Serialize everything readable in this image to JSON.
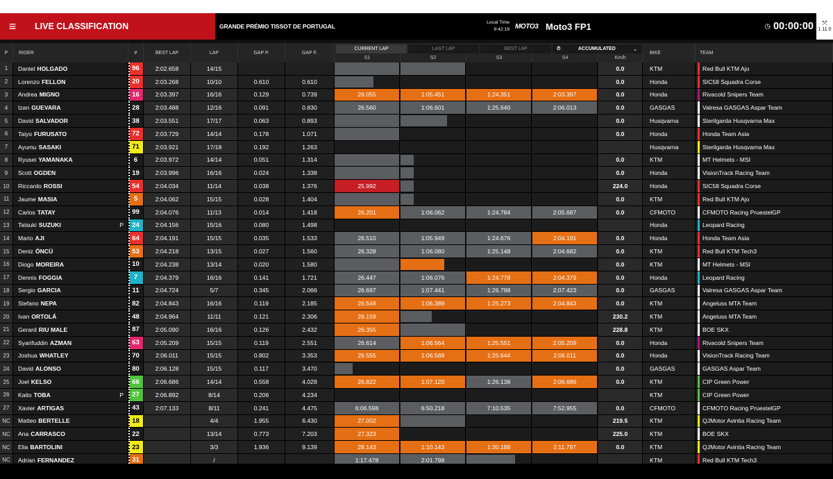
{
  "header": {
    "menu_icon": "hamburger-icon",
    "title": "LIVE CLASSIFICATION",
    "event": "GRANDE PRÉMIO TISSOT DE PORTUGAL",
    "local_time_label": "Local Time",
    "local_time": "9:42:19",
    "logo": "MOTO3",
    "session": "Moto3 FP1",
    "clock": "00:00:00",
    "version": "1.11.0"
  },
  "columns": {
    "p": "P",
    "rider": "RIDER",
    "num": "#",
    "best": "BEST LAP",
    "lap": "LAP",
    "gapp": "GAP P.",
    "gapf": "GAP F.",
    "tab_current": "CURRENT LAP",
    "tab_last": "LAST LAP",
    "tab_best": "BEST LAP",
    "accumulated": "ACCUMULATED",
    "s1": "S1",
    "s2": "S2",
    "s3": "S3",
    "s4": "S4",
    "kmh": "Km/h",
    "bike": "BIKE",
    "team": "TEAM"
  },
  "colors": {
    "orange": "#e56f14",
    "red": "#c51e25",
    "grey": "#5b5d61"
  },
  "rows": [
    {
      "p": "1",
      "first": "Daniel",
      "last": "HOLGADO",
      "num": "96",
      "nb": "#e8312c",
      "nc": "#fff",
      "best": "2:02.658",
      "lap": "14/15",
      "gapp": "",
      "gapf": "",
      "s": [
        [
          "g",
          100,
          ""
        ],
        [
          "g",
          100,
          ""
        ],
        [
          "",
          0,
          ""
        ],
        [
          "",
          0,
          ""
        ]
      ],
      "kmh": "0.0",
      "bike": "KTM",
      "team": "Red Bull KTM Ajo",
      "tc": "#e8312c"
    },
    {
      "p": "2",
      "first": "Lorenzo",
      "last": "FELLON",
      "num": "20",
      "nb": "#e8312c",
      "nc": "#fff",
      "best": "2:03.268",
      "lap": "10/10",
      "gapp": "0.610",
      "gapf": "0.610",
      "s": [
        [
          "g",
          60,
          ""
        ],
        [
          "",
          0,
          ""
        ],
        [
          "",
          0,
          ""
        ],
        [
          "",
          0,
          ""
        ]
      ],
      "kmh": "0.0",
      "bike": "Honda",
      "team": "SIC58 Squadra Corse",
      "tc": "#e8312c"
    },
    {
      "p": "3",
      "first": "Andrea",
      "last": "MIGNO",
      "num": "16",
      "nb": "#e0266e",
      "nc": "#fff",
      "best": "2:03.397",
      "lap": "16/16",
      "gapp": "0.129",
      "gapf": "0.739",
      "s": [
        [
          "o",
          100,
          "26.055"
        ],
        [
          "o",
          100,
          "1:05.451"
        ],
        [
          "o",
          100,
          "1:24.351"
        ],
        [
          "o",
          100,
          "2:03.397"
        ]
      ],
      "kmh": "0.0",
      "bike": "Honda",
      "team": "Rivacold Snipers Team",
      "tc": "#b5127a"
    },
    {
      "p": "4",
      "first": "Izan",
      "last": "GUEVARA",
      "num": "28",
      "nb": "",
      "nc": "#fff",
      "best": "2:03.488",
      "lap": "12/16",
      "gapp": "0.091",
      "gapf": "0.830",
      "s": [
        [
          "g",
          100,
          "26.560"
        ],
        [
          "g",
          100,
          "1:06.601"
        ],
        [
          "g",
          100,
          "1:25.640"
        ],
        [
          "g",
          100,
          "2:06.013"
        ]
      ],
      "kmh": "0.0",
      "bike": "GASGAS",
      "team": "Valresa GASGAS Aspar Team",
      "tc": "#fff"
    },
    {
      "p": "5",
      "first": "David",
      "last": "SALVADOR",
      "num": "38",
      "nb": "",
      "nc": "#fff",
      "best": "2:03.551",
      "lap": "17/17",
      "gapp": "0.063",
      "gapf": "0.893",
      "s": [
        [
          "g",
          100,
          ""
        ],
        [
          "g",
          72,
          ""
        ],
        [
          "",
          0,
          ""
        ],
        [
          "",
          0,
          ""
        ]
      ],
      "kmh": "0.0",
      "bike": "Husqvarna",
      "team": "Sterilgarda Husqvarna Max",
      "tc": "#fff"
    },
    {
      "p": "6",
      "first": "Taiyo",
      "last": "FURUSATO",
      "num": "72",
      "nb": "#e8312c",
      "nc": "#fff",
      "best": "2:03.729",
      "lap": "14/14",
      "gapp": "0.178",
      "gapf": "1.071",
      "s": [
        [
          "g",
          100,
          ""
        ],
        [
          "",
          0,
          ""
        ],
        [
          "",
          0,
          ""
        ],
        [
          "",
          0,
          ""
        ]
      ],
      "kmh": "0.0",
      "bike": "Honda",
      "team": "Honda Team Asia",
      "tc": "#e8312c"
    },
    {
      "p": "7",
      "first": "Ayumu",
      "last": "SASAKI",
      "num": "71",
      "nb": "#f1ea1c",
      "nc": "#000",
      "best": "2:03.921",
      "lap": "17/18",
      "gapp": "0.192",
      "gapf": "1.263",
      "s": [
        [
          "",
          0,
          ""
        ],
        [
          "",
          0,
          ""
        ],
        [
          "",
          0,
          ""
        ],
        [
          "",
          0,
          ""
        ]
      ],
      "kmh": "",
      "bike": "Husqvarna",
      "team": "Sterilgarda Husqvarna Max",
      "tc": "#f1ea1c"
    },
    {
      "p": "8",
      "first": "Ryusei",
      "last": "YAMANAKA",
      "num": "6",
      "nb": "",
      "nc": "#fff",
      "best": "2:03.972",
      "lap": "14/14",
      "gapp": "0.051",
      "gapf": "1.314",
      "s": [
        [
          "g",
          100,
          ""
        ],
        [
          "g",
          20,
          ""
        ],
        [
          "",
          0,
          ""
        ],
        [
          "",
          0,
          ""
        ]
      ],
      "kmh": "0.0",
      "bike": "KTM",
      "team": "MT Helmets - MSI",
      "tc": "#fff"
    },
    {
      "p": "9",
      "first": "Scott",
      "last": "OGDEN",
      "num": "19",
      "nb": "",
      "nc": "#fff",
      "best": "2:03.996",
      "lap": "16/16",
      "gapp": "0.024",
      "gapf": "1.338",
      "s": [
        [
          "g",
          100,
          ""
        ],
        [
          "g",
          20,
          ""
        ],
        [
          "",
          0,
          ""
        ],
        [
          "",
          0,
          ""
        ]
      ],
      "kmh": "0.0",
      "bike": "Honda",
      "team": "VisionTrack Racing Team",
      "tc": "#fff"
    },
    {
      "p": "10",
      "first": "Riccardo",
      "last": "ROSSI",
      "num": "54",
      "nb": "#e8312c",
      "nc": "#fff",
      "best": "2:04.034",
      "lap": "11/14",
      "gapp": "0.038",
      "gapf": "1.376",
      "s": [
        [
          "r",
          100,
          "25.992"
        ],
        [
          "g",
          20,
          ""
        ],
        [
          "",
          0,
          ""
        ],
        [
          "",
          0,
          ""
        ]
      ],
      "kmh": "224.0",
      "bike": "Honda",
      "team": "SIC58 Squadra Corse",
      "tc": "#e8312c"
    },
    {
      "p": "11",
      "first": "Jaume",
      "last": "MASIA",
      "num": "5",
      "nb": "#e56f14",
      "nc": "#fff",
      "best": "2:04.062",
      "lap": "15/15",
      "gapp": "0.028",
      "gapf": "1.404",
      "s": [
        [
          "g",
          100,
          ""
        ],
        [
          "g",
          20,
          ""
        ],
        [
          "",
          0,
          ""
        ],
        [
          "",
          0,
          ""
        ]
      ],
      "kmh": "0.0",
      "bike": "KTM",
      "team": "Red Bull KTM Ajo",
      "tc": "#e8312c"
    },
    {
      "p": "12",
      "first": "Carlos",
      "last": "TATAY",
      "num": "99",
      "nb": "",
      "nc": "#fff",
      "best": "2:04.076",
      "lap": "11/13",
      "gapp": "0.014",
      "gapf": "1.418",
      "s": [
        [
          "o",
          100,
          "26.201"
        ],
        [
          "g",
          100,
          "1:06.062"
        ],
        [
          "g",
          100,
          "1:24.784"
        ],
        [
          "g",
          100,
          "2:05.687"
        ]
      ],
      "kmh": "0.0",
      "bike": "CFMOTO",
      "team": "CFMOTO Racing PruestelGP",
      "tc": "#fff"
    },
    {
      "p": "13",
      "first": "Tatsuki",
      "last": "SUZUKI",
      "pen": "P",
      "num": "24",
      "nb": "#1fb3c7",
      "nc": "#fff",
      "best": "2:04.156",
      "lap": "15/16",
      "gapp": "0.080",
      "gapf": "1.498",
      "s": [
        [
          "",
          0,
          ""
        ],
        [
          "",
          0,
          ""
        ],
        [
          "",
          0,
          ""
        ],
        [
          "",
          0,
          ""
        ]
      ],
      "kmh": "",
      "bike": "Honda",
      "team": "Leopard Racing",
      "tc": "#1fb3c7"
    },
    {
      "p": "14",
      "first": "Mario",
      "last": "AJI",
      "num": "64",
      "nb": "#e8312c",
      "nc": "#fff",
      "best": "2:04.191",
      "lap": "15/15",
      "gapp": "0.035",
      "gapf": "1.533",
      "s": [
        [
          "g",
          100,
          "26.510"
        ],
        [
          "g",
          100,
          "1:05.949"
        ],
        [
          "g",
          100,
          "1:24.676"
        ],
        [
          "o",
          100,
          "2:04.191"
        ]
      ],
      "kmh": "0.0",
      "bike": "Honda",
      "team": "Honda Team Asia",
      "tc": "#e8312c"
    },
    {
      "p": "15",
      "first": "Deniz",
      "last": "ÖNCÜ",
      "num": "53",
      "nb": "#e56f14",
      "nc": "#fff",
      "best": "2:04.218",
      "lap": "13/15",
      "gapp": "0.027",
      "gapf": "1.560",
      "s": [
        [
          "g",
          100,
          "26.328"
        ],
        [
          "g",
          100,
          "1:06.080"
        ],
        [
          "g",
          100,
          "1:25.148"
        ],
        [
          "g",
          100,
          "2:04.682"
        ]
      ],
      "kmh": "0.0",
      "bike": "KTM",
      "team": "Red Bull KTM Tech3",
      "tc": "#e8312c"
    },
    {
      "p": "16",
      "first": "Diogo",
      "last": "MOREIRA",
      "num": "10",
      "nb": "",
      "nc": "#fff",
      "best": "2:04.238",
      "lap": "13/14",
      "gapp": "0.020",
      "gapf": "1.580",
      "s": [
        [
          "g",
          100,
          ""
        ],
        [
          "o",
          68,
          ""
        ],
        [
          "",
          0,
          ""
        ],
        [
          "",
          0,
          ""
        ]
      ],
      "kmh": "0.0",
      "bike": "KTM",
      "team": "MT Helmets - MSI",
      "tc": "#fff"
    },
    {
      "p": "17",
      "first": "Dennis",
      "last": "FOGGIA",
      "num": "7",
      "nb": "#1fb3c7",
      "nc": "#fff",
      "best": "2:04.379",
      "lap": "16/16",
      "gapp": "0.141",
      "gapf": "1.721",
      "s": [
        [
          "g",
          100,
          "26.447"
        ],
        [
          "g",
          100,
          "1:06.076"
        ],
        [
          "o",
          100,
          "1:24.778"
        ],
        [
          "o",
          100,
          "2:04.379"
        ]
      ],
      "kmh": "0.0",
      "bike": "Honda",
      "team": "Leopard Racing",
      "tc": "#1fb3c7"
    },
    {
      "p": "18",
      "first": "Sergio",
      "last": "GARCIA",
      "num": "11",
      "nb": "",
      "nc": "#fff",
      "best": "2:04.724",
      "lap": "5/7",
      "gapp": "0.345",
      "gapf": "2.066",
      "s": [
        [
          "g",
          100,
          "26.697"
        ],
        [
          "g",
          100,
          "1:07.441"
        ],
        [
          "g",
          100,
          "1:26.798"
        ],
        [
          "g",
          100,
          "2:07.423"
        ]
      ],
      "kmh": "0.0",
      "bike": "GASGAS",
      "team": "Valresa GASGAS Aspar Team",
      "tc": "#fff"
    },
    {
      "p": "19",
      "first": "Stefano",
      "last": "NEPA",
      "num": "82",
      "nb": "",
      "nc": "#fff",
      "best": "2:04.843",
      "lap": "16/16",
      "gapp": "0.119",
      "gapf": "2.185",
      "s": [
        [
          "o",
          100,
          "26.548"
        ],
        [
          "o",
          100,
          "1:06.389"
        ],
        [
          "o",
          100,
          "1:25.273"
        ],
        [
          "o",
          100,
          "2:04.843"
        ]
      ],
      "kmh": "0.0",
      "bike": "KTM",
      "team": "Angeluss MTA Team",
      "tc": "#fff"
    },
    {
      "p": "20",
      "first": "Ivan",
      "last": "ORTOLÁ",
      "num": "48",
      "nb": "",
      "nc": "#fff",
      "best": "2:04.964",
      "lap": "11/11",
      "gapp": "0.121",
      "gapf": "2.306",
      "s": [
        [
          "o",
          100,
          "26.159"
        ],
        [
          "g",
          48,
          ""
        ],
        [
          "",
          0,
          ""
        ],
        [
          "",
          0,
          ""
        ]
      ],
      "kmh": "230.2",
      "bike": "KTM",
      "team": "Angeluss MTA Team",
      "tc": "#fff"
    },
    {
      "p": "21",
      "first": "Gerard",
      "last": "RIU MALE",
      "num": "87",
      "nb": "",
      "nc": "#fff",
      "best": "2:05.090",
      "lap": "16/16",
      "gapp": "0.126",
      "gapf": "2.432",
      "s": [
        [
          "o",
          100,
          "26.355"
        ],
        [
          "g",
          100,
          ""
        ],
        [
          "",
          0,
          ""
        ],
        [
          "",
          0,
          ""
        ]
      ],
      "kmh": "228.8",
      "bike": "KTM",
      "team": "BOE SKX",
      "tc": "#fff"
    },
    {
      "p": "22",
      "first": "Syarifuddin",
      "last": "AZMAN",
      "num": "63",
      "nb": "#e0266e",
      "nc": "#fff",
      "best": "2:05.209",
      "lap": "15/15",
      "gapp": "0.119",
      "gapf": "2.551",
      "s": [
        [
          "g",
          100,
          "26.614"
        ],
        [
          "o",
          100,
          "1:06.564"
        ],
        [
          "o",
          100,
          "1:25.551"
        ],
        [
          "o",
          100,
          "2:05.209"
        ]
      ],
      "kmh": "0.0",
      "bike": "Honda",
      "team": "Rivacold Snipers Team",
      "tc": "#b5127a"
    },
    {
      "p": "23",
      "first": "Joshua",
      "last": "WHATLEY",
      "num": "70",
      "nb": "",
      "nc": "#fff",
      "best": "2:06.011",
      "lap": "15/15",
      "gapp": "0.802",
      "gapf": "3.353",
      "s": [
        [
          "o",
          100,
          "26.555"
        ],
        [
          "o",
          100,
          "1:06.588"
        ],
        [
          "o",
          100,
          "1:25.644"
        ],
        [
          "o",
          100,
          "2:06.011"
        ]
      ],
      "kmh": "0.0",
      "bike": "Honda",
      "team": "VisionTrack Racing Team",
      "tc": "#fff"
    },
    {
      "p": "24",
      "first": "David",
      "last": "ALONSO",
      "num": "80",
      "nb": "",
      "nc": "#fff",
      "best": "2:06.128",
      "lap": "15/15",
      "gapp": "0.117",
      "gapf": "3.470",
      "s": [
        [
          "g",
          28,
          ""
        ],
        [
          "",
          0,
          ""
        ],
        [
          "",
          0,
          ""
        ],
        [
          "",
          0,
          ""
        ]
      ],
      "kmh": "0.0",
      "bike": "GASGAS",
      "team": "GASGAS Aspar Team",
      "tc": "#fff"
    },
    {
      "p": "25",
      "first": "Joel",
      "last": "KELSO",
      "num": "66",
      "nb": "#52c23c",
      "nc": "#fff",
      "best": "2:06.686",
      "lap": "14/14",
      "gapp": "0.558",
      "gapf": "4.028",
      "s": [
        [
          "o",
          100,
          "26.822"
        ],
        [
          "o",
          100,
          "1:07.120"
        ],
        [
          "g",
          100,
          "1:26.138"
        ],
        [
          "o",
          100,
          "2:06.686"
        ]
      ],
      "kmh": "0.0",
      "bike": "KTM",
      "team": "CIP Green Power",
      "tc": "#52c23c"
    },
    {
      "p": "26",
      "first": "Kaito",
      "last": "TOBA",
      "pen": "P",
      "num": "27",
      "nb": "#52c23c",
      "nc": "#fff",
      "best": "2:06.892",
      "lap": "8/14",
      "gapp": "0.206",
      "gapf": "4.234",
      "s": [
        [
          "",
          0,
          ""
        ],
        [
          "",
          0,
          ""
        ],
        [
          "",
          0,
          ""
        ],
        [
          "",
          0,
          ""
        ]
      ],
      "kmh": "",
      "bike": "KTM",
      "team": "CIP Green Power",
      "tc": "#52c23c"
    },
    {
      "p": "27",
      "first": "Xavier",
      "last": "ARTIGAS",
      "num": "43",
      "nb": "",
      "nc": "#fff",
      "best": "2:07.133",
      "lap": "8/11",
      "gapp": "0.241",
      "gapf": "4.475",
      "s": [
        [
          "g",
          100,
          "6:06.598"
        ],
        [
          "g",
          100,
          "6:50.218"
        ],
        [
          "g",
          100,
          "7:10.535"
        ],
        [
          "g",
          100,
          "7:52.955"
        ]
      ],
      "kmh": "0.0",
      "bike": "CFMOTO",
      "team": "CFMOTO Racing PruestelGP",
      "tc": "#fff"
    },
    {
      "p": "NC",
      "first": "Matteo",
      "last": "BERTELLE",
      "num": "18",
      "nb": "#f1ea1c",
      "nc": "#000",
      "best": "",
      "lap": "4/4",
      "gapp": "1.955",
      "gapf": "6.430",
      "s": [
        [
          "o",
          100,
          "27.002"
        ],
        [
          "g",
          100,
          ""
        ],
        [
          "",
          0,
          ""
        ],
        [
          "",
          0,
          ""
        ]
      ],
      "kmh": "219.5",
      "bike": "KTM",
      "team": "QJMotor Avintia Racing Team",
      "tc": "#f1ea1c"
    },
    {
      "p": "NC",
      "first": "Ana",
      "last": "CARRASCO",
      "num": "22",
      "nb": "",
      "nc": "#fff",
      "best": "",
      "lap": "13/14",
      "gapp": "0.773",
      "gapf": "7.203",
      "s": [
        [
          "o",
          100,
          "27.323"
        ],
        [
          "",
          0,
          ""
        ],
        [
          "",
          0,
          ""
        ],
        [
          "",
          0,
          ""
        ]
      ],
      "kmh": "225.0",
      "bike": "KTM",
      "team": "BOE SKX",
      "tc": "#fff"
    },
    {
      "p": "NC",
      "first": "Elia",
      "last": "BARTOLINI",
      "num": "23",
      "nb": "#f1ea1c",
      "nc": "#000",
      "best": "",
      "lap": "3/3",
      "gapp": "1.936",
      "gapf": "9.139",
      "s": [
        [
          "o",
          100,
          "28.143"
        ],
        [
          "o",
          100,
          "1:10.143"
        ],
        [
          "o",
          100,
          "1:30.188"
        ],
        [
          "o",
          100,
          "2:11.797"
        ]
      ],
      "kmh": "0.0",
      "bike": "KTM",
      "team": "QJMotor Avintia Racing Team",
      "tc": "#f1ea1c"
    },
    {
      "p": "NC",
      "first": "Adrian",
      "last": "FERNANDEZ",
      "num": "31",
      "nb": "#e56f14",
      "nc": "#fff",
      "best": "",
      "lap": "/",
      "gapp": "",
      "gapf": "",
      "s": [
        [
          "g",
          100,
          "1:17.478"
        ],
        [
          "g",
          100,
          "2:01.798"
        ],
        [
          "g",
          75,
          ""
        ],
        [
          "",
          0,
          ""
        ]
      ],
      "kmh": "",
      "bike": "KTM",
      "team": "Red Bull KTM Tech3",
      "tc": "#e8312c"
    }
  ]
}
